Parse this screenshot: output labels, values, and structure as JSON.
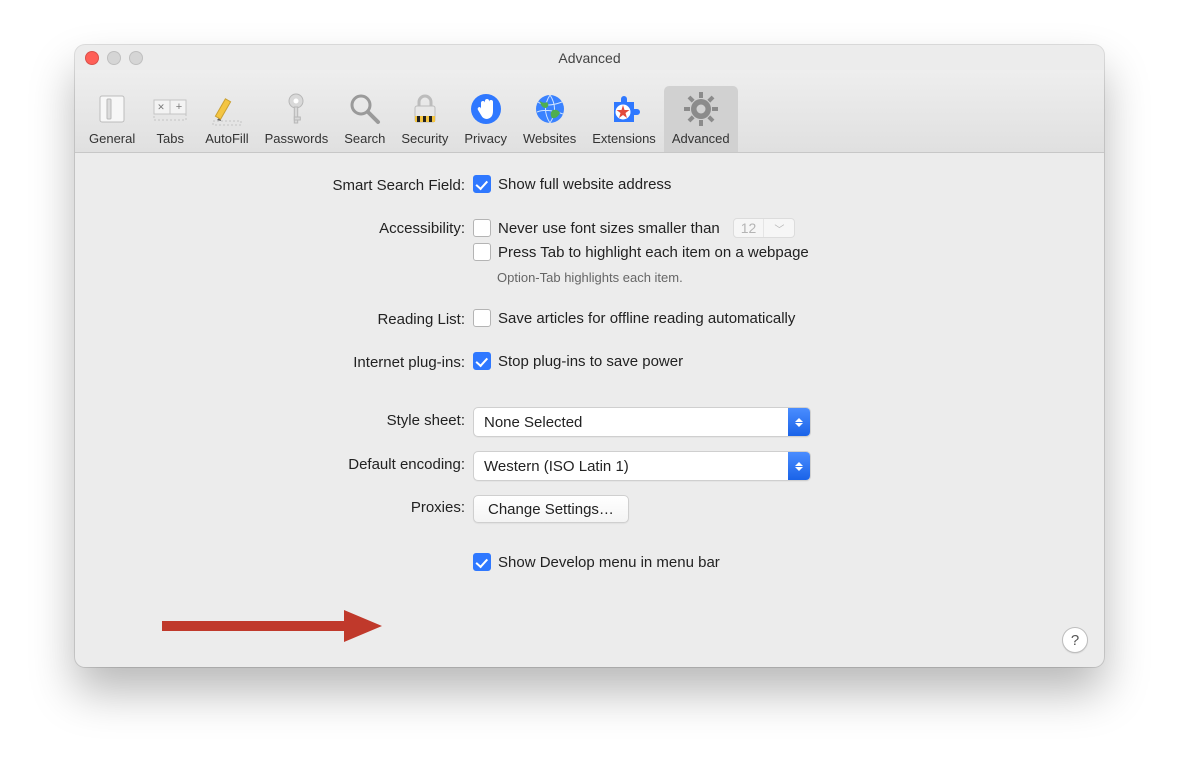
{
  "window": {
    "title": "Advanced"
  },
  "toolbar": {
    "active": "Advanced",
    "items": [
      {
        "id": "general",
        "label": "General"
      },
      {
        "id": "tabs",
        "label": "Tabs"
      },
      {
        "id": "autofill",
        "label": "AutoFill"
      },
      {
        "id": "passwords",
        "label": "Passwords"
      },
      {
        "id": "search",
        "label": "Search"
      },
      {
        "id": "security",
        "label": "Security"
      },
      {
        "id": "privacy",
        "label": "Privacy"
      },
      {
        "id": "websites",
        "label": "Websites"
      },
      {
        "id": "extensions",
        "label": "Extensions"
      },
      {
        "id": "advanced",
        "label": "Advanced"
      }
    ]
  },
  "form": {
    "smart_search": {
      "label": "Smart Search Field:",
      "show_full_url": {
        "checked": true,
        "label": "Show full website address"
      }
    },
    "accessibility": {
      "label": "Accessibility:",
      "min_font": {
        "checked": false,
        "label": "Never use font sizes smaller than",
        "value": "12"
      },
      "tab_highlight": {
        "checked": false,
        "label": "Press Tab to highlight each item on a webpage"
      },
      "hint": "Option-Tab highlights each item."
    },
    "reading_list": {
      "label": "Reading List:",
      "offline": {
        "checked": false,
        "label": "Save articles for offline reading automatically"
      }
    },
    "plugins": {
      "label": "Internet plug-ins:",
      "stop_power": {
        "checked": true,
        "label": "Stop plug-ins to save power"
      }
    },
    "stylesheet": {
      "label": "Style sheet:",
      "value": "None Selected"
    },
    "encoding": {
      "label": "Default encoding:",
      "value": "Western (ISO Latin 1)"
    },
    "proxies": {
      "label": "Proxies:",
      "button": "Change Settings…"
    },
    "develop": {
      "checked": true,
      "label": "Show Develop menu in menu bar"
    }
  },
  "help_glyph": "?"
}
